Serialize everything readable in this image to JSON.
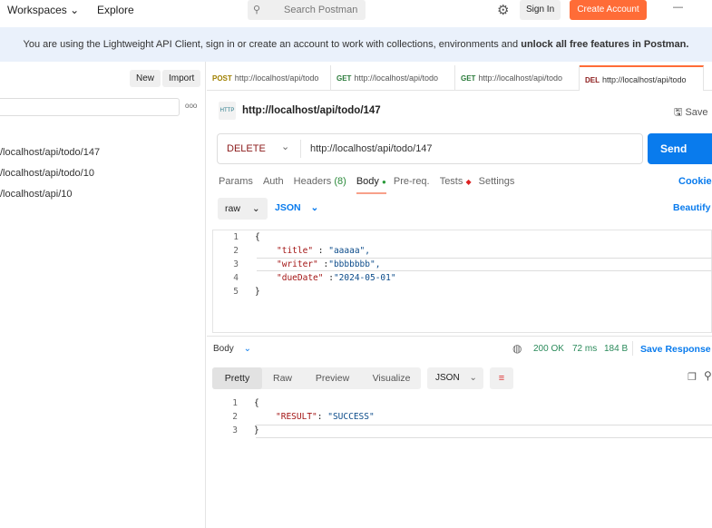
{
  "top": {
    "workspaces": "Workspaces",
    "explore": "Explore",
    "search_placeholder": "Search Postman",
    "sign_in": "Sign In",
    "create_account": "Create Account"
  },
  "banner": {
    "text": "You are using the Lightweight API Client, sign in or create an account to work with collections, environments and ",
    "bold": "unlock all free features in Postman."
  },
  "sidebar": {
    "new": "New",
    "import": "Import",
    "more": "ooo",
    "history": [
      "/localhost/api/todo/147",
      "/localhost/api/todo/10",
      "/localhost/api/10"
    ]
  },
  "tabs": [
    {
      "method": "POST",
      "url": "http://localhost/api/todo",
      "color": "#a08000"
    },
    {
      "method": "GET",
      "url": "http://localhost/api/todo",
      "color": "#2a7b3a"
    },
    {
      "method": "GET",
      "url": "http://localhost/api/todo",
      "color": "#2a7b3a"
    },
    {
      "method": "DEL",
      "url": "http://localhost/api/todo",
      "color": "#8b1a1a"
    }
  ],
  "request": {
    "icon_label": "HTTP",
    "title": "http://localhost/api/todo/147",
    "save": "Save",
    "method": "DELETE",
    "url": "http://localhost/api/todo/147",
    "send": "Send"
  },
  "req_tabs": {
    "params": "Params",
    "auth": "Auth",
    "headers": "Headers",
    "headers_count": "(8)",
    "body": "Body",
    "prereq": "Pre-req.",
    "tests": "Tests",
    "settings": "Settings",
    "cookies": "Cookies"
  },
  "body_opts": {
    "mode": "raw",
    "lang": "JSON",
    "beautify": "Beautify"
  },
  "req_body": [
    {
      "n": "1",
      "t": "{"
    },
    {
      "n": "2",
      "k": "\"title\"",
      "sep": " : ",
      "v": "\"aaaaa\","
    },
    {
      "n": "3",
      "k": "\"writer\"",
      "sep": " :",
      "v": "\"bbbbbbb\","
    },
    {
      "n": "4",
      "k": "\"dueDate\"",
      "sep": " :",
      "v": "\"2024-05-01\""
    },
    {
      "n": "5",
      "t": "}"
    }
  ],
  "response": {
    "body": "Body",
    "status": "200 OK",
    "time": "72 ms",
    "size": "184 B",
    "save": "Save Response",
    "tabs": [
      "Pretty",
      "Raw",
      "Preview",
      "Visualize"
    ],
    "lang": "JSON",
    "lines": [
      {
        "n": "1",
        "t": "{"
      },
      {
        "n": "2",
        "k": "\"RESULT\"",
        "sep": ": ",
        "v": "\"SUCCESS\""
      },
      {
        "n": "3",
        "t": "}"
      }
    ]
  }
}
